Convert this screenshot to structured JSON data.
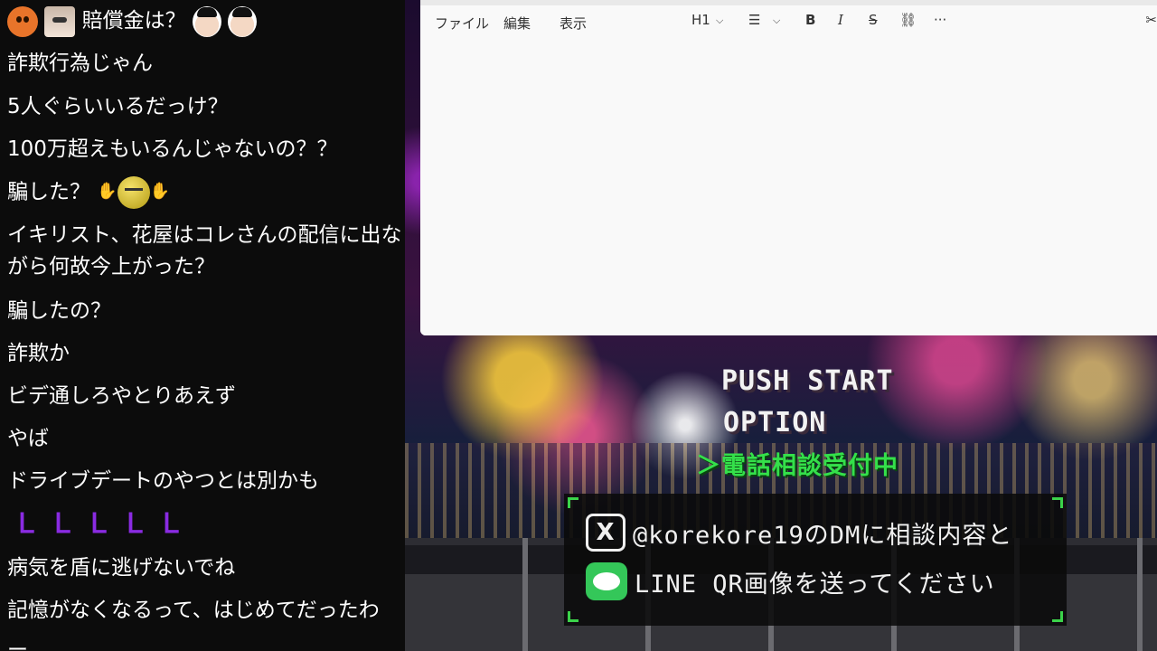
{
  "chat": {
    "messages": [
      {
        "text": "賠償金は？"
      },
      {
        "text": "詐欺行為じゃん"
      },
      {
        "text": "5人ぐらいいるだっけ？"
      },
      {
        "text": "100万超えもいるんじゃないの？？"
      },
      {
        "text": "騙した？"
      },
      {
        "text": "イキリスト、花屋はコレさんの配信に出ながら何故今上がった？"
      },
      {
        "text": "騙したの？"
      },
      {
        "text": "詐欺か"
      },
      {
        "text": "ビデ通しろやとりあえず"
      },
      {
        "text": "やば"
      },
      {
        "text": "ドライブデートのやつとは別かも"
      },
      {
        "text": "ＬＬＬＬＬ"
      },
      {
        "text": "病気を盾に逃げないでね"
      },
      {
        "text": "記憶がなくなるって、はじめてだったわ"
      },
      {
        "text": "ー"
      }
    ],
    "emoji_icons": [
      "orange-face-icon",
      "photo-face-icon",
      "person-face-icon",
      "person-face-icon",
      "yellow-face-icon"
    ],
    "purple_color": "#8a2be2"
  },
  "editor": {
    "menu": {
      "file": "ファイル",
      "edit": "編集",
      "view": "表示"
    },
    "toolbar": {
      "heading": "H1",
      "chevron": "⌵",
      "list": "☰",
      "bold": "B",
      "italic": "I",
      "strike": "S",
      "link": "⛓",
      "more": "···",
      "cut": "✂"
    }
  },
  "game": {
    "push_start": "PUSH START",
    "option": "OPTION",
    "phone_cursor": "＞",
    "phone": "電話相談受付中",
    "contact_x_logo": "X",
    "contact_x": "@korekore19のDMに相談内容と",
    "contact_line": "LINE QR画像を送ってください",
    "accent_color": "#34e04a"
  }
}
